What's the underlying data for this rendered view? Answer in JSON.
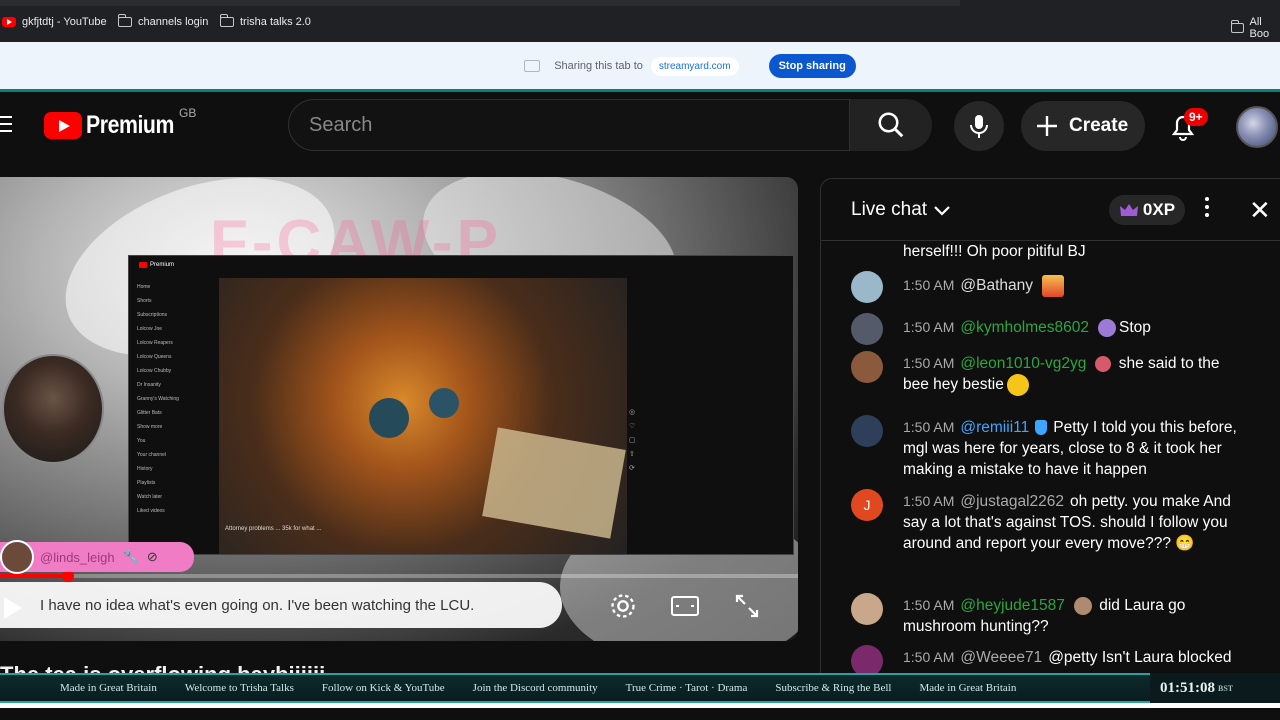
{
  "bookmarks": [
    {
      "label": "gkfjtdtj - YouTube",
      "icon": "youtube-icon"
    },
    {
      "label": "channels login",
      "icon": "folder-icon"
    },
    {
      "label": "trisha talks 2.0",
      "icon": "folder-icon"
    },
    {
      "label": "All Boo",
      "icon": "folder-icon"
    }
  ],
  "sharebar": {
    "text": "Sharing this tab to",
    "domain": "streamyard.com",
    "stop_label": "Stop sharing"
  },
  "header": {
    "logo_word": "Premium",
    "region": "GB",
    "search_placeholder": "Search",
    "create_label": "Create",
    "notif_badge": "9+"
  },
  "video": {
    "watermark": "F-CAW-P",
    "caption_user": "@linds_leigh",
    "caption_text": "I have no idea what's even going on. I've been watching the LCU.",
    "inner_caption": "Attorney problems ... 35k for what ...",
    "inner_logo": "Premium",
    "inner_sidebar": [
      "Home",
      "Shorts",
      "Subscriptions",
      "Lolcow Joe",
      "Lolcow Reapers",
      "Lolcow Queens",
      "Lolcow Chubby",
      "Dr Insanity",
      "Granny's Watching",
      "Glitter Bats",
      "Show more",
      "You",
      "Your channel",
      "History",
      "Playlists",
      "Watch later",
      "Liked videos"
    ]
  },
  "video_title": "The tea is overflowing baybiiiiii",
  "chat": {
    "title": "Live chat",
    "xp": "0XP",
    "messages": [
      {
        "time": "",
        "author": "",
        "text": "herself!!! Oh poor pitiful BJ",
        "avatar": "#6b6b6b"
      },
      {
        "time": "1:50 AM",
        "author": "@Bathany",
        "text": "",
        "avatar": "#9ab8c9",
        "emoji": "popcorn-icon",
        "plain": true
      },
      {
        "time": "1:50 AM",
        "author": "@kymholmes8602",
        "text": "Stop",
        "avatar": "#555a6a",
        "emoji": "poop-icon"
      },
      {
        "time": "1:50 AM",
        "author": "@leon1010-vg2yg",
        "text": "she said to the bee hey bestie",
        "avatar": "#8b5a3c",
        "emoji": "nauseated-face-icon"
      },
      {
        "time": "1:50 AM",
        "author": "@remiii11",
        "text": "Petty I told you this before, mgl was here for years, close to 8 & it took her making a mistake to have it happen",
        "avatar": "#2e3f5a"
      },
      {
        "time": "1:50 AM",
        "author": "@justagal2262",
        "text": "oh petty. you make And say a lot that's against TOS. should I follow you around and report your every move??? 😁",
        "avatar": "#e0481f",
        "initial": "J",
        "plain": true
      },
      {
        "time": "1:50 AM",
        "author": "@heyjude1587",
        "text": "did Laura go mushroom hunting??",
        "avatar": "#c8a78a"
      },
      {
        "time": "1:50 AM",
        "author": "@Weeee71",
        "text": "@petty Isn't Laura blocked",
        "avatar": "#7a2a6a",
        "plain": true
      }
    ]
  },
  "ticker": {
    "items": [
      "Made in Great Britain",
      "Welcome to Trisha Talks",
      "Follow on Kick & YouTube",
      "Join the Discord community",
      "True Crime · Tarot · Drama",
      "Subscribe & Ring the Bell",
      "Made in Great Britain"
    ],
    "time": "01:51:08",
    "tz": "BST"
  }
}
